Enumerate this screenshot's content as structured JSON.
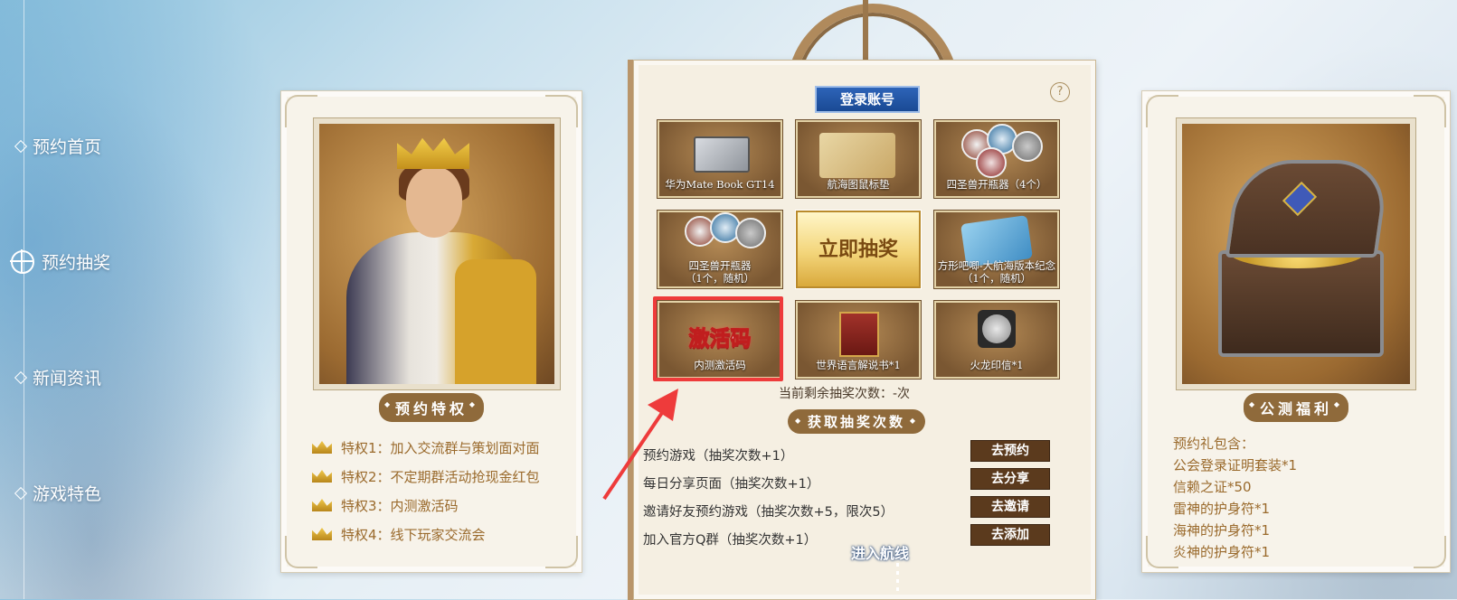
{
  "nav": {
    "items": [
      {
        "label": "预约首页"
      },
      {
        "label": "预约抽奖"
      },
      {
        "label": "新闻资讯"
      },
      {
        "label": "游戏特色"
      }
    ]
  },
  "left_card": {
    "ribbon": "预约特权",
    "privileges": [
      "特权1：加入交流群与策划面对面",
      "特权2：不定期群活动抢现金红包",
      "特权3：内测激活码",
      "特权4：线下玩家交流会"
    ]
  },
  "center": {
    "login_label": "登录账号",
    "help_label": "?",
    "prizes": [
      {
        "label": "华为Mate Book GT14"
      },
      {
        "label": "航海图鼠标垫"
      },
      {
        "label": "四圣兽开瓶器（4个）"
      },
      {
        "label": "四圣兽开瓶器\n（1个，随机）"
      },
      {
        "label": "立即抽奖"
      },
      {
        "label": "方形吧唧-大航海版本纪念\n（1个，随机）"
      },
      {
        "label": "内测激活码",
        "big_text": "激活码"
      },
      {
        "label": "世界语言解说书*1"
      },
      {
        "label": "火龙印信*1"
      }
    ],
    "remaining_text": "当前剩余抽奖次数：-次",
    "tasks_ribbon": "获取抽奖次数",
    "tasks": [
      {
        "text": "预约游戏（抽奖次数+1）",
        "button": "去预约"
      },
      {
        "text": "每日分享页面（抽奖次数+1）",
        "button": "去分享"
      },
      {
        "text": "邀请好友预约游戏（抽奖次数+5，限次5）",
        "button": "去邀请"
      },
      {
        "text": "加入官方Q群（抽奖次数+1）",
        "button": "去添加"
      }
    ],
    "enter_link": "进入航线"
  },
  "right_card": {
    "ribbon": "公测福利",
    "gifts": [
      "预约礼包含：",
      "公会登录证明套装*1",
      "信赖之证*50",
      "雷神的护身符*1",
      "海神的护身符*1",
      "炎神的护身符*1"
    ]
  },
  "colors": {
    "accent_brown": "#8f6a3b",
    "login_blue": "#1a4a94",
    "highlight_red": "#ee3b3b",
    "text_gold": "#9a6a2c"
  }
}
